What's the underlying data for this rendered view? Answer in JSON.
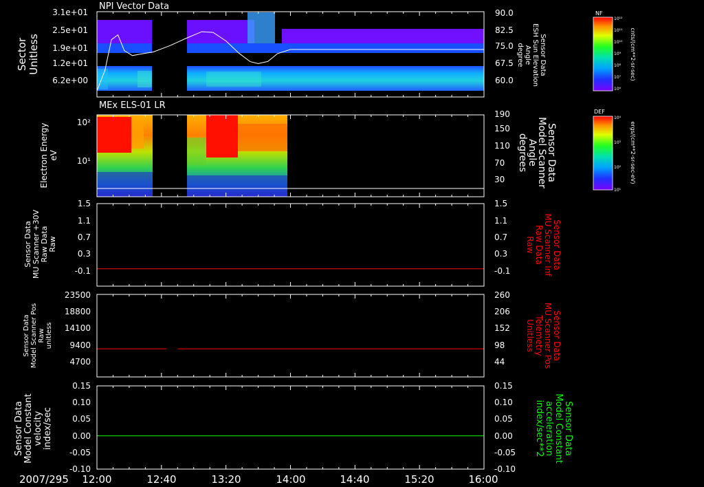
{
  "colors": {
    "background": "#000000",
    "axis": "#ffffff",
    "red_trace": "#ff0000",
    "green_trace": "#00ff00"
  },
  "footer": {
    "date": "2007/295",
    "time_ticks": [
      "12:00",
      "12:40",
      "13:20",
      "14:00",
      "14:40",
      "15:20",
      "16:00"
    ]
  },
  "colorbars": [
    {
      "label": "NF",
      "unit": "cnts/(cm**2-sr-sec)",
      "ticks": [
        "10¹²",
        "10¹¹",
        "10¹⁰",
        "10⁹",
        "10⁸",
        "10⁷",
        "10⁶"
      ]
    },
    {
      "label": "DEF",
      "unit": "ergs/(cm**2-sr-sec-eV)",
      "ticks": [
        "10⁴",
        "10³",
        "10²",
        "10¹"
      ]
    }
  ],
  "chart_data": [
    {
      "type": "heatmap",
      "title": "NPI Vector Data",
      "ylabel": [
        "Sector",
        "Unitless"
      ],
      "yticks": [
        "3.1e+01",
        "2.5e+01",
        "1.9e+01",
        "1.2e+01",
        "6.2e+00"
      ],
      "y2label": [
        "Sensor Data",
        "ESH Sun Elevation",
        "Angle",
        "degree"
      ],
      "y2ticks": [
        "90.0",
        "82.5",
        "75.0",
        "67.5",
        "60.0"
      ],
      "y2lim": [
        55,
        90
      ],
      "data_gap": [
        "12:47",
        "12:53"
      ],
      "overlay_line": {
        "name": "ESH Sun Elevation Angle",
        "x": [
          "12:00",
          "12:05",
          "12:09",
          "12:13",
          "12:17",
          "12:22",
          "12:27",
          "12:35",
          "12:45",
          "12:55",
          "13:05",
          "13:12",
          "13:20",
          "13:28",
          "13:35",
          "13:40",
          "13:46",
          "13:52",
          "14:00",
          "14:30",
          "15:00",
          "15:30",
          "16:00"
        ],
        "y": [
          57.5,
          66,
          78.5,
          80.5,
          74,
          72,
          72.6,
          73.5,
          76,
          79,
          81.8,
          81.5,
          78,
          73,
          69.5,
          68.7,
          69.6,
          72.8,
          74.5,
          74.5,
          74.5,
          74.5,
          74.5
        ]
      }
    },
    {
      "type": "heatmap",
      "title": "MEx ELS-01 LR",
      "ylabel": [
        "Electron Energy",
        "eV"
      ],
      "yticks": [
        "10²",
        "10¹"
      ],
      "y2label": [
        "Sensor Data",
        "Model Scanner",
        "Angle",
        "degrees"
      ],
      "y2ticks": [
        "190",
        "150",
        "110",
        "70",
        "30"
      ],
      "y2lim": [
        10,
        190
      ],
      "data_coverage": [
        [
          "12:00",
          "12:41"
        ],
        [
          "12:51",
          "13:58"
        ]
      ],
      "overlay_line": {
        "name": "Model Scanner Angle",
        "x": [
          "12:00",
          "16:00"
        ],
        "y": [
          20,
          20
        ]
      }
    },
    {
      "type": "line",
      "ylabel": [
        "Sensor Data",
        "MU Scanner +30V",
        "Raw Data",
        "Raw"
      ],
      "yticks": [
        "1.5",
        "1.1",
        "0.7",
        "0.3",
        "-0.1"
      ],
      "ylim": [
        -0.4,
        1.5
      ],
      "y2label": [
        "Sensor Data",
        "MU Scanner Inf",
        "Raw Data",
        "Raw"
      ],
      "y2ticks": [
        "1.5",
        "1.1",
        "0.7",
        "0.3",
        "-0.1"
      ],
      "series": [
        {
          "x": [
            "12:00",
            "16:00"
          ],
          "y": [
            0.0,
            0.0
          ]
        }
      ]
    },
    {
      "type": "line",
      "ylabel": [
        "Sensor Data",
        "Model Scanner Pos",
        "Raw",
        "unitless"
      ],
      "yticks": [
        "23500",
        "18800",
        "14100",
        "9400",
        "4700"
      ],
      "ylim": [
        0,
        23500
      ],
      "y2label": [
        "Sensor Data",
        "MU Scanner Pos",
        "Telemetry",
        "Unitless"
      ],
      "y2ticks": [
        "260",
        "206",
        "152",
        "98",
        "44"
      ],
      "series": [
        {
          "segments": [
            [
              "12:00",
              "12:43"
            ],
            [
              "12:50",
              "16:00"
            ]
          ],
          "y": 8000
        }
      ]
    },
    {
      "type": "line",
      "ylabel": [
        "Sensor Data",
        "Model Constant",
        "velocity",
        "index/sec"
      ],
      "yticks": [
        "0.15",
        "0.10",
        "0.05",
        "0.00",
        "-0.05",
        "-0.10"
      ],
      "ylim": [
        -0.1,
        0.15
      ],
      "y2label": [
        "Sensor Data",
        "Model Constant",
        "acceleration",
        "index/sec**2"
      ],
      "y2ticks": [
        "0.15",
        "0.10",
        "0.05",
        "0.00",
        "-0.05",
        "-0.10"
      ],
      "series": [
        {
          "x": [
            "12:00",
            "16:00"
          ],
          "y": [
            0.0,
            0.0
          ]
        }
      ]
    }
  ]
}
